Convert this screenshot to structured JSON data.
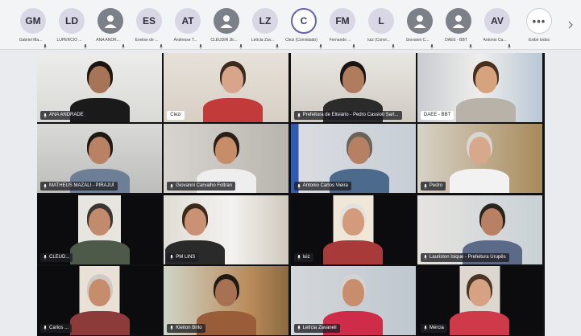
{
  "participants_bar": {
    "items": [
      {
        "initials": "GM",
        "name": "Gabriel Ma...",
        "style": "initials"
      },
      {
        "initials": "LD",
        "name": "LUPERCIO ...",
        "style": "initials"
      },
      {
        "initials": "",
        "name": "ANA ANDR...",
        "style": "gray"
      },
      {
        "initials": "ES",
        "name": "Evelise de ...",
        "style": "initials"
      },
      {
        "initials": "AT",
        "name": "Andresse T...",
        "style": "initials"
      },
      {
        "initials": "",
        "name": "CLEUDIR JE...",
        "style": "gray"
      },
      {
        "initials": "LZ",
        "name": "Letícia Zav...",
        "style": "initials"
      },
      {
        "initials": "C",
        "name": "Clezi (Convidado)",
        "style": "ring"
      },
      {
        "initials": "FM",
        "name": "Fernando ...",
        "style": "initials"
      },
      {
        "initials": "L",
        "name": "luiz (Convi...",
        "style": "initials"
      },
      {
        "initials": "",
        "name": "Giovanni C...",
        "style": "gray"
      },
      {
        "initials": "",
        "name": "DAEE - BBT",
        "style": "gray"
      },
      {
        "initials": "AV",
        "name": "Antonio Ca...",
        "style": "initials"
      }
    ],
    "more": {
      "symbol": "•••",
      "label": "Exibir todos"
    }
  },
  "colors": {
    "accent": "#6264a7",
    "initials_avatar": "#d9d6e6",
    "gray_avatar": "#7c8088"
  },
  "tiles": [
    {
      "label": "ANA ANDRADE",
      "mic": true
    },
    {
      "label": "Clezi",
      "mic": false
    },
    {
      "label": "Prefeitura de Elisiário - Pedro Cassioti Sart...",
      "mic": true
    },
    {
      "label": "DAEE - BBT",
      "mic": false
    },
    {
      "label": "MATHEUS MAZALI - PIRAJUÍ",
      "mic": true
    },
    {
      "label": "Giovanni Carvalho Foltran",
      "mic": true
    },
    {
      "label": "Antonio Carlos Vieira",
      "mic": true
    },
    {
      "label": "Pedro",
      "mic": true
    },
    {
      "label": "CLEUD...",
      "mic": true
    },
    {
      "label": "PM LINS",
      "mic": true
    },
    {
      "label": "luiz",
      "mic": true
    },
    {
      "label": "Lauriston Isique - Prefeitura Urupês",
      "mic": true
    },
    {
      "label": "Carlos ...",
      "mic": true
    },
    {
      "label": "Kleiton Brito",
      "mic": true
    },
    {
      "label": "Letícia Zavaneli",
      "mic": true
    },
    {
      "label": "Mércia",
      "mic": true
    }
  ]
}
